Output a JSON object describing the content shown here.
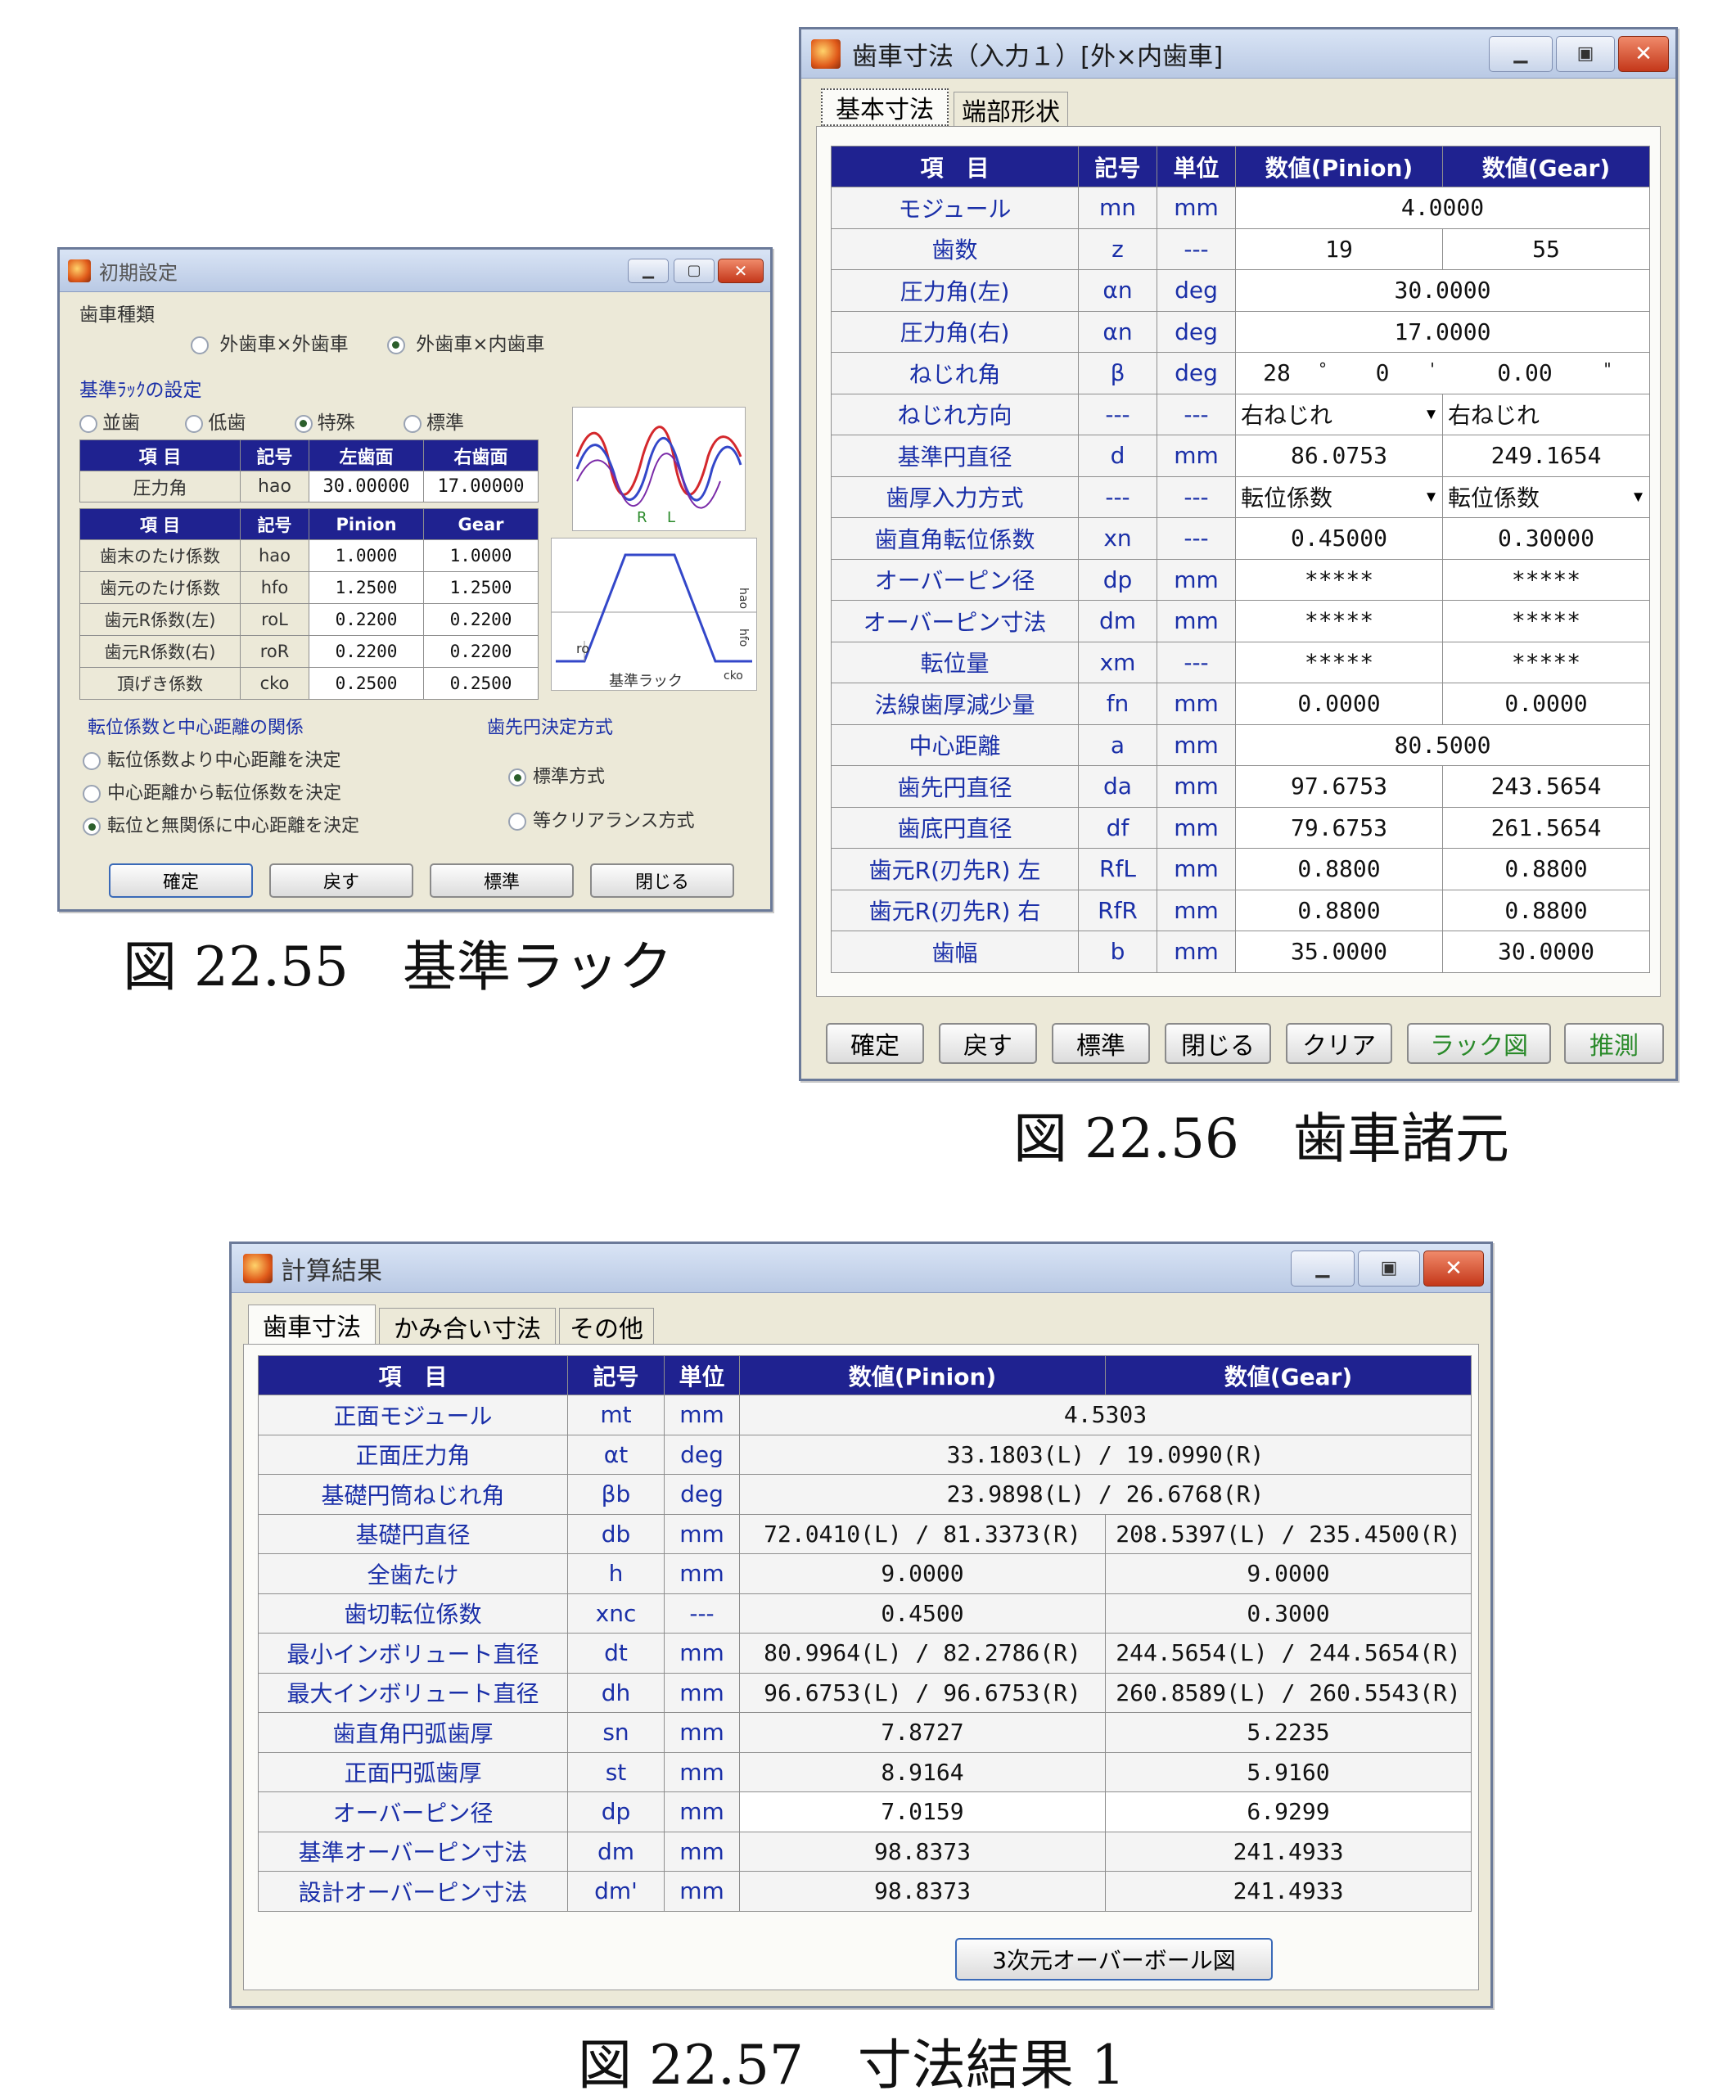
{
  "win1": {
    "title": "初期設定",
    "gear_kind_label": "歯車種類",
    "gear_kind_options": [
      "外歯車×外歯車",
      "外歯車×内歯車"
    ],
    "gear_kind_selected": 1,
    "rack_label": "基準ﾗｯｸの設定",
    "rack_options": [
      "並歯",
      "低歯",
      "特殊",
      "標準"
    ],
    "rack_selected": 2,
    "table1": {
      "headers": [
        "項 目",
        "記号",
        "左歯面",
        "右歯面"
      ],
      "rows": [
        [
          "圧力角",
          "hao",
          "30.00000",
          "17.00000"
        ]
      ]
    },
    "table2": {
      "headers": [
        "項 目",
        "記号",
        "Pinion",
        "Gear"
      ],
      "rows": [
        [
          "歯末のたけ係数",
          "hao",
          "1.0000",
          "1.0000"
        ],
        [
          "歯元のたけ係数",
          "hfo",
          "1.2500",
          "1.2500"
        ],
        [
          "歯元R係数(左)",
          "roL",
          "0.2200",
          "0.2200"
        ],
        [
          "歯元R係数(右)",
          "roR",
          "0.2200",
          "0.2200"
        ],
        [
          "頂げき係数",
          "cko",
          "0.2500",
          "0.2500"
        ]
      ]
    },
    "diagram": {
      "labels": [
        "R",
        "L"
      ],
      "rack_label": "基準ラック",
      "dim_labels": [
        "hao",
        "hfo",
        "ro",
        "cko"
      ]
    },
    "relation_label": "転位係数と中心距離の関係",
    "relation_options": [
      "転位係数より中心距離を決定",
      "中心距離から転位係数を決定",
      "転位と無関係に中心距離を決定"
    ],
    "relation_selected": 2,
    "tip_label": "歯先円決定方式",
    "tip_options": [
      "標準方式",
      "等クリアランス方式"
    ],
    "tip_selected": 0,
    "buttons": [
      "確定",
      "戻す",
      "標準",
      "閉じる"
    ]
  },
  "caption1": "図 22.55　基準ラック",
  "win2": {
    "title": "歯車寸法（入力１）[外×内歯車]",
    "tabs": [
      "基本寸法",
      "端部形状"
    ],
    "headers": [
      "項　目",
      "記号",
      "単位",
      "数値(Pinion)",
      "数値(Gear)"
    ],
    "rows": [
      {
        "item": "モジュール",
        "sym": "mn",
        "unit": "mm",
        "merged": "4.0000"
      },
      {
        "item": "歯数",
        "sym": "z",
        "unit": "---",
        "p": "19",
        "g": "55"
      },
      {
        "item": "圧力角(左)",
        "sym": "αn",
        "unit": "deg",
        "merged": "30.0000"
      },
      {
        "item": "圧力角(右)",
        "sym": "αn",
        "unit": "deg",
        "merged": "17.0000"
      },
      {
        "item": "ねじれ角",
        "sym": "β",
        "unit": "deg",
        "angle": [
          "28",
          "0",
          "0.00"
        ],
        "angle_marks": [
          "°",
          "'",
          "\""
        ]
      },
      {
        "item": "ねじれ方向",
        "sym": "---",
        "unit": "---",
        "p": "右ねじれ",
        "g": "右ねじれ"
      },
      {
        "item": "基準円直径",
        "sym": "d",
        "unit": "mm",
        "p": "86.0753",
        "g": "249.1654"
      },
      {
        "item": "歯厚入力方式",
        "sym": "---",
        "unit": "---",
        "p": "転位係数",
        "g": "転位係数"
      },
      {
        "item": "歯直角転位係数",
        "sym": "xn",
        "unit": "---",
        "p": "0.45000",
        "g": "0.30000"
      },
      {
        "item": "オーバーピン径",
        "sym": "dp",
        "unit": "mm",
        "p": "*****",
        "g": "*****"
      },
      {
        "item": "オーバーピン寸法",
        "sym": "dm",
        "unit": "mm",
        "p": "*****",
        "g": "*****"
      },
      {
        "item": "転位量",
        "sym": "xm",
        "unit": "---",
        "p": "*****",
        "g": "*****"
      },
      {
        "item": "法線歯厚減少量",
        "sym": "fn",
        "unit": "mm",
        "p": "0.0000",
        "g": "0.0000"
      },
      {
        "item": "中心距離",
        "sym": "a",
        "unit": "mm",
        "merged": "80.5000"
      },
      {
        "item": "歯先円直径",
        "sym": "da",
        "unit": "mm",
        "p": "97.6753",
        "g": "243.5654"
      },
      {
        "item": "歯底円直径",
        "sym": "df",
        "unit": "mm",
        "p": "79.6753",
        "g": "261.5654"
      },
      {
        "item": "歯元R(刃先R) 左",
        "sym": "RfL",
        "unit": "mm",
        "p": "0.8800",
        "g": "0.8800"
      },
      {
        "item": "歯元R(刃先R) 右",
        "sym": "RfR",
        "unit": "mm",
        "p": "0.8800",
        "g": "0.8800"
      },
      {
        "item": "歯幅",
        "sym": "b",
        "unit": "mm",
        "p": "35.0000",
        "g": "30.0000"
      }
    ],
    "buttons": [
      "確定",
      "戻す",
      "標準",
      "閉じる",
      "クリア",
      "ラック図",
      "推測"
    ]
  },
  "caption2": "図 22.56　歯車諸元",
  "win3": {
    "title": "計算結果",
    "tabs": [
      "歯車寸法",
      "かみ合い寸法",
      "その他"
    ],
    "headers": [
      "項　目",
      "記号",
      "単位",
      "数値(Pinion)",
      "数値(Gear)"
    ],
    "rows": [
      {
        "item": "正面モジュール",
        "sym": "mt",
        "unit": "mm",
        "merged": "4.5303"
      },
      {
        "item": "正面圧力角",
        "sym": "αt",
        "unit": "deg",
        "merged": "33.1803(L) / 19.0990(R)"
      },
      {
        "item": "基礎円筒ねじれ角",
        "sym": "βb",
        "unit": "deg",
        "merged": "23.9898(L) / 26.6768(R)"
      },
      {
        "item": "基礎円直径",
        "sym": "db",
        "unit": "mm",
        "p": "72.0410(L) / 81.3373(R)",
        "g": "208.5397(L) / 235.4500(R)"
      },
      {
        "item": "全歯たけ",
        "sym": "h",
        "unit": "mm",
        "p": "9.0000",
        "g": "9.0000"
      },
      {
        "item": "歯切転位係数",
        "sym": "xnc",
        "unit": "---",
        "p": "0.4500",
        "g": "0.3000"
      },
      {
        "item": "最小インボリュート直径",
        "sym": "dt",
        "unit": "mm",
        "p": "80.9964(L) / 82.2786(R)",
        "g": "244.5654(L) / 244.5654(R)"
      },
      {
        "item": "最大インボリュート直径",
        "sym": "dh",
        "unit": "mm",
        "p": "96.6753(L) / 96.6753(R)",
        "g": "260.8589(L) / 260.5543(R)"
      },
      {
        "item": "歯直角円弧歯厚",
        "sym": "sn",
        "unit": "mm",
        "p": "7.8727",
        "g": "5.2235"
      },
      {
        "item": "正面円弧歯厚",
        "sym": "st",
        "unit": "mm",
        "p": "8.9164",
        "g": "5.9160"
      },
      {
        "item": "オーバーピン径",
        "sym": "dp",
        "unit": "mm",
        "p": "7.0159",
        "g": "6.9299"
      },
      {
        "item": "基準オーバーピン寸法",
        "sym": "dm",
        "unit": "mm",
        "p": "98.8373",
        "g": "241.4933"
      },
      {
        "item": "設計オーバーピン寸法",
        "sym": "dm'",
        "unit": "mm",
        "p": "98.8373",
        "g": "241.4933"
      }
    ],
    "button": "3次元オーバーボール図"
  },
  "caption3": "図 22.57　寸法結果 1",
  "colors": {
    "header_bg": "#1f2290",
    "label_text": "#1a2fa8",
    "accent_green": "#2a8a2a"
  },
  "icons": {
    "window_icon": "app-icon",
    "minimize": "minimize-icon",
    "maximize": "maximize-icon",
    "close": "close-icon"
  }
}
